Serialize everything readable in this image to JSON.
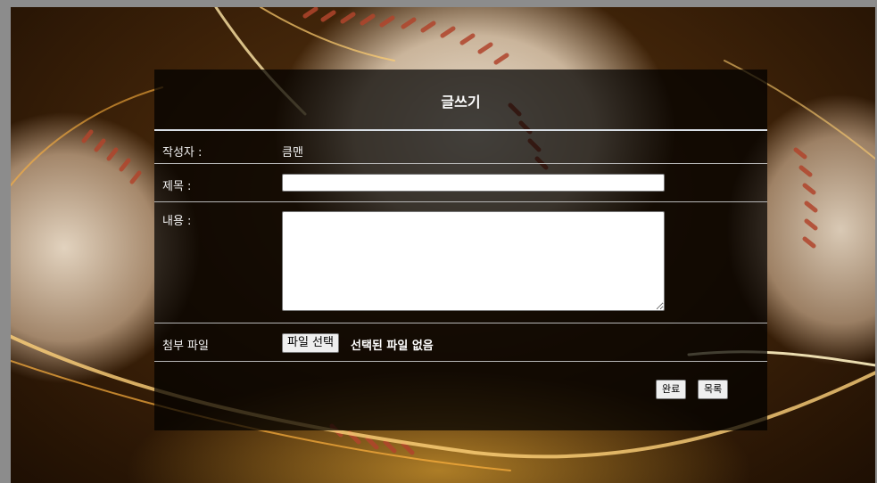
{
  "form": {
    "title": "글쓰기",
    "author_label": "작성자 :",
    "author_value": "큼맨",
    "subject_label": "제목 :",
    "subject_value": "",
    "content_label": "내용 :",
    "content_value": "",
    "attachment_label": "첨부 파일",
    "file_button_label": "파일 선택",
    "file_status": "선택된 파일 없음",
    "submit_label": "완료",
    "list_label": "목록"
  },
  "colors": {
    "panel_background": "#000000b8",
    "title_divider": "#d9dfe6",
    "row_divider": "#b7b7b7",
    "text": "#ffffff"
  }
}
